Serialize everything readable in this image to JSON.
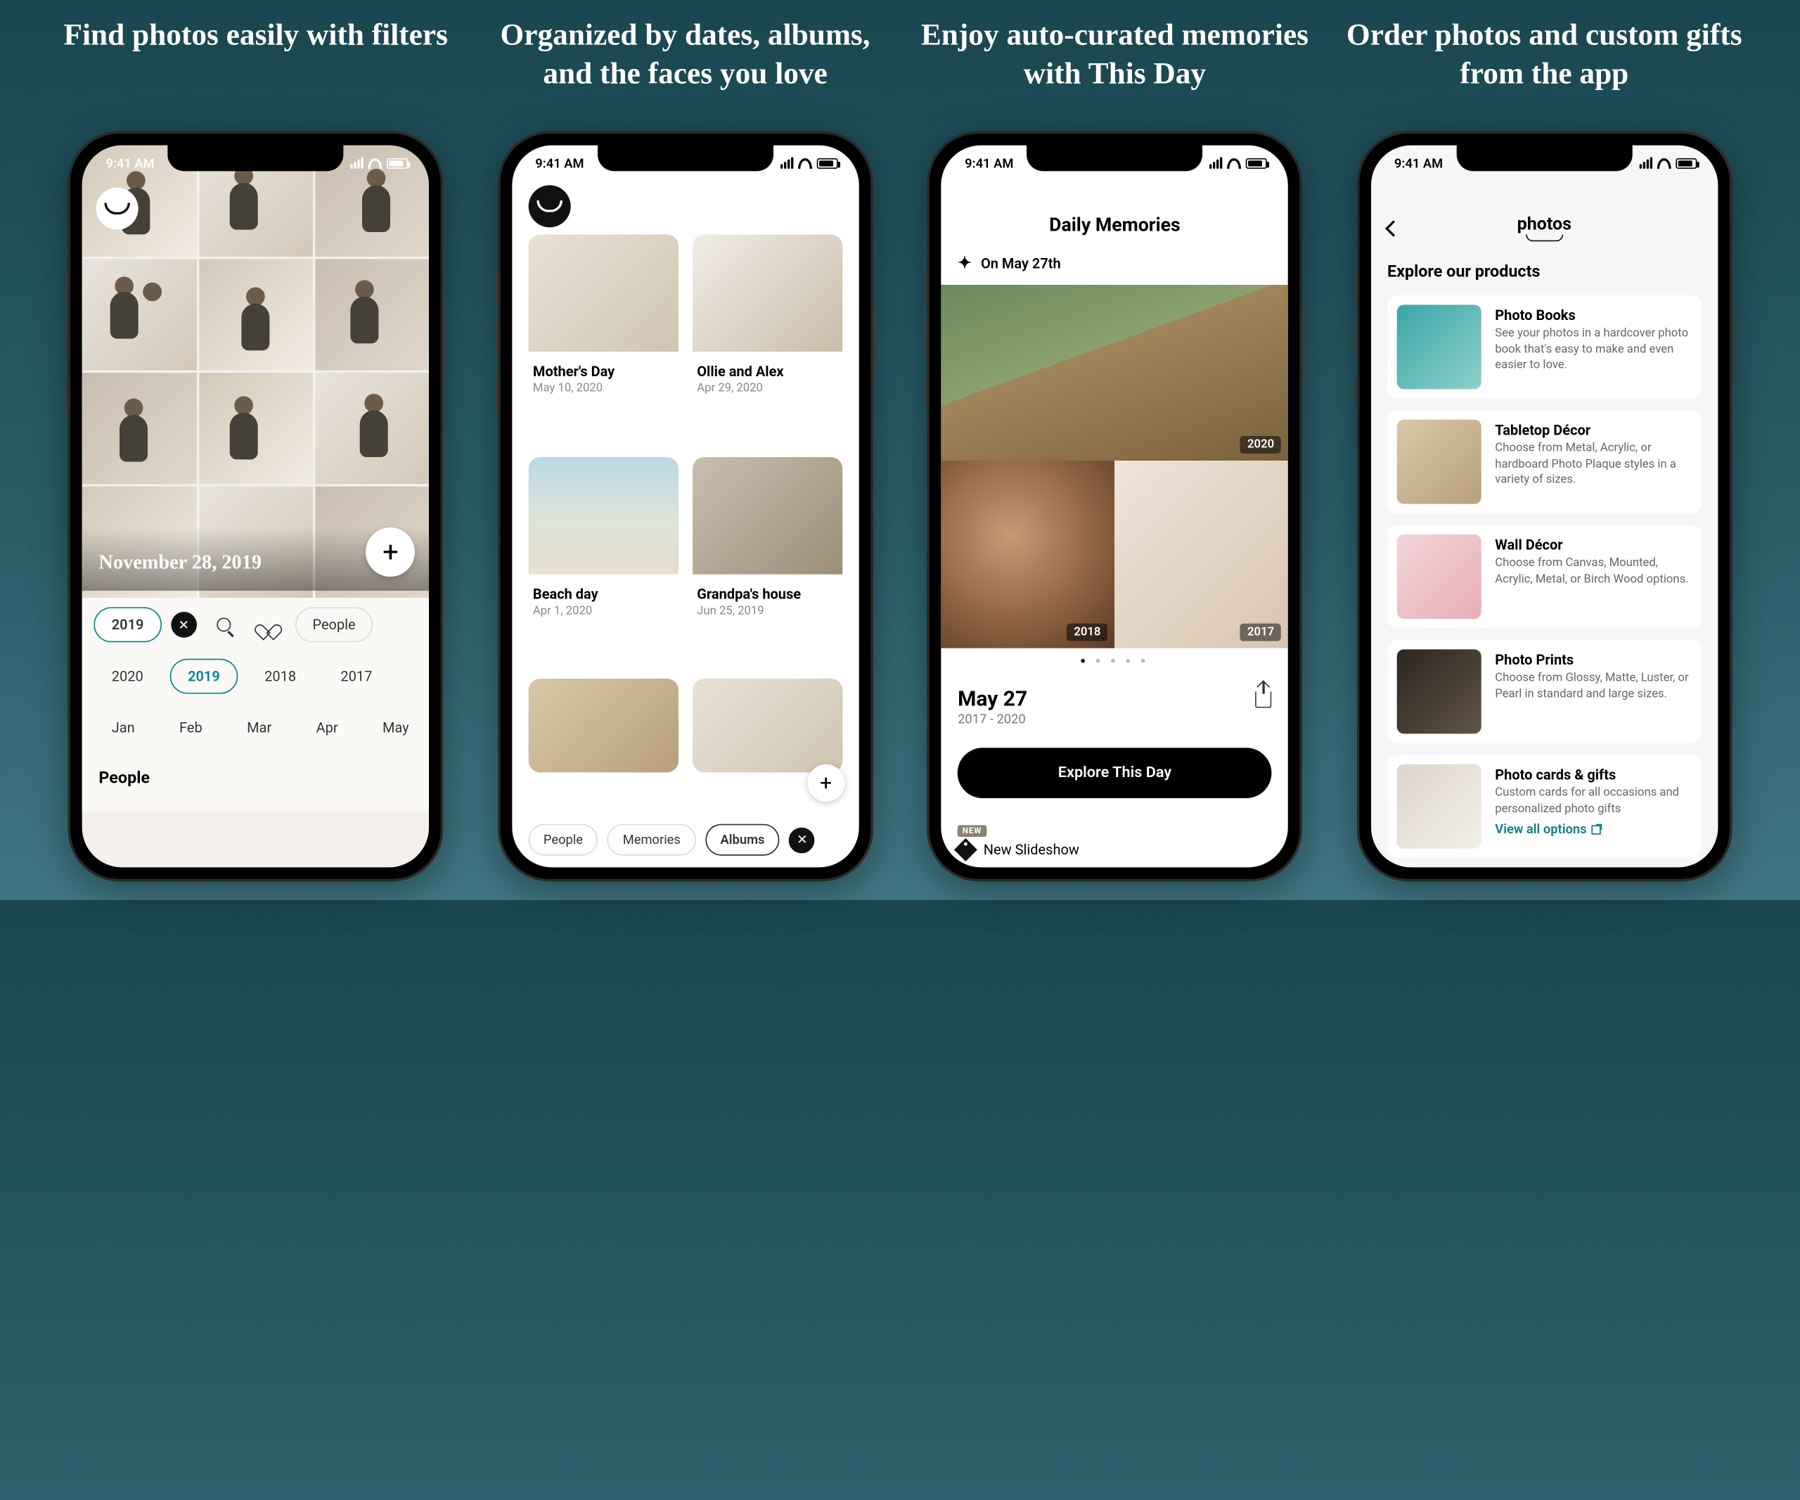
{
  "status_time": "9:41 AM",
  "features": [
    {
      "title": "Find photos easily with filters"
    },
    {
      "title": "Organized by dates, albums, and the faces you love"
    },
    {
      "title": "Enjoy auto-curated memories with This Day"
    },
    {
      "title": "Order photos and custom gifts from the app"
    }
  ],
  "filters_screen": {
    "date_label": "November 28, 2019",
    "active_filter": "2019",
    "people_chip": "People",
    "years": [
      "2020",
      "2019",
      "2018",
      "2017"
    ],
    "months": [
      "Jan",
      "Feb",
      "Mar",
      "Apr",
      "May"
    ],
    "people_section": "People"
  },
  "albums_screen": {
    "albums": [
      {
        "title": "Mother's Day",
        "date": "May 10, 2020"
      },
      {
        "title": "Ollie and Alex",
        "date": "Apr 29, 2020"
      },
      {
        "title": "Beach day",
        "date": "Apr 1, 2020"
      },
      {
        "title": "Grandpa's house",
        "date": "Jun 25, 2019"
      }
    ],
    "chips": [
      "People",
      "Memories",
      "Albums"
    ]
  },
  "memories_screen": {
    "header": "Daily Memories",
    "on_date": "On May 27th",
    "years": [
      "2020",
      "2018",
      "2017"
    ],
    "day_title": "May 27",
    "year_range": "2017 - 2020",
    "explore_btn": "Explore This Day",
    "new_slideshow": "New Slideshow",
    "new_badge": "NEW"
  },
  "products_screen": {
    "logo_text": "photos",
    "section_title": "Explore our products",
    "products": [
      {
        "title": "Photo Books",
        "desc": "See your photos in a hardcover photo book that's easy to make and even easier to love."
      },
      {
        "title": "Tabletop Décor",
        "desc": "Choose from Metal, Acrylic, or hardboard Photo Plaque styles in a variety of sizes."
      },
      {
        "title": "Wall Décor",
        "desc": "Choose from Canvas, Mounted, Acrylic, Metal, or Birch Wood options."
      },
      {
        "title": "Photo Prints",
        "desc": "Choose from Glossy, Matte, Luster, or Pearl in standard and large sizes."
      },
      {
        "title": "Photo cards & gifts",
        "desc": "Custom cards for all occasions and personalized photo gifts"
      }
    ],
    "view_all": "View all options"
  }
}
